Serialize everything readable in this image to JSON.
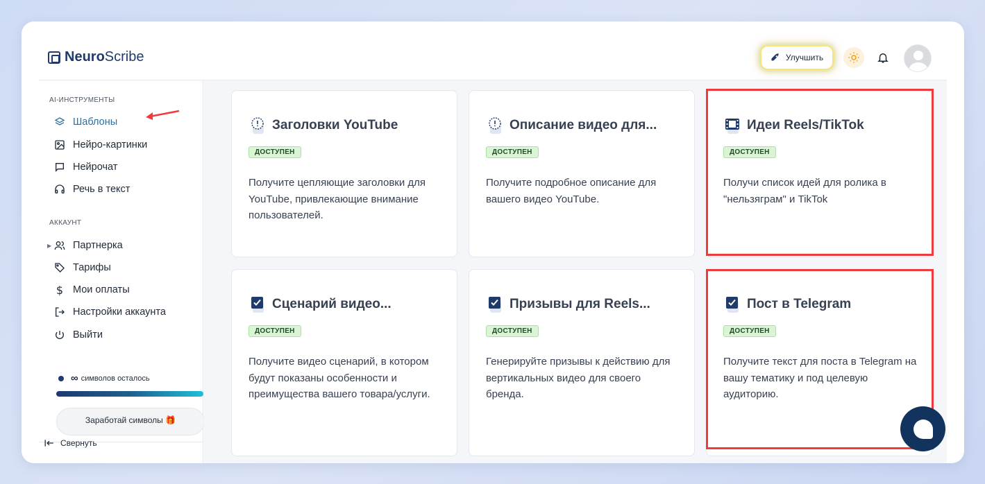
{
  "app": {
    "logo_bold": "Neuro",
    "logo_rest": "Scribe",
    "upgrade_label": "Улучшить"
  },
  "sidebar": {
    "ai_section": "AI-ИНСТРУМЕНТЫ",
    "ai_items": [
      {
        "label": "Шаблоны",
        "icon": "layers-icon",
        "active": true
      },
      {
        "label": "Нейро-картинки",
        "icon": "image-icon"
      },
      {
        "label": "Нейрочат",
        "icon": "chat-icon"
      },
      {
        "label": "Речь в текст",
        "icon": "headphones-icon"
      }
    ],
    "account_section": "АККАУНТ",
    "account_items": [
      {
        "label": "Партнерка",
        "icon": "users-icon"
      },
      {
        "label": "Тарифы",
        "icon": "tag-icon"
      },
      {
        "label": "Мои оплаты",
        "icon": "dollar-icon"
      },
      {
        "label": "Настройки аккаунта",
        "icon": "logout-arrow-icon"
      },
      {
        "label": "Выйти",
        "icon": "power-icon"
      }
    ],
    "symbols_value": "∞",
    "symbols_label": "символов осталось",
    "earn_label": "Заработай символы 🎁",
    "collapse_label": "Свернуть"
  },
  "cards": [
    {
      "title": "Заголовки YouTube",
      "badge": "ДОСТУПЕН",
      "desc": "Получите цепляющие заголовки для YouTube, привлекающие внимание пользователей.",
      "icon": "alert-clock-icon"
    },
    {
      "title": "Описание видео для...",
      "badge": "ДОСТУПЕН",
      "desc": "Получите подробное описание для вашего видео YouTube.",
      "icon": "alert-clock-icon"
    },
    {
      "title": "Идеи Reels/TikTok",
      "badge": "ДОСТУПЕН",
      "desc": "Получи список идей для ролика в \"нельзяграм\" и TikTok",
      "icon": "film-icon"
    },
    {
      "title": "Сценарий видео...",
      "badge": "ДОСТУПЕН",
      "desc": "Получите видео сценарий, в котором будут показаны особенности и преимущества вашего товара/услуги.",
      "icon": "checkbox-icon"
    },
    {
      "title": "Призывы для Reels...",
      "badge": "ДОСТУПЕН",
      "desc": "Генерируйте призывы к действию для вертикальных видео для своего бренда.",
      "icon": "checkbox-icon"
    },
    {
      "title": "Пост в Telegram",
      "badge": "ДОСТУПЕН",
      "desc": "Получите текст для поста в Telegram на вашу тематику и под целевую аудиторию.",
      "icon": "checkbox-icon"
    }
  ],
  "colors": {
    "accent": "#1f3b6b",
    "highlight": "#ef3b3b",
    "badge_bg": "#d9f5d3"
  }
}
